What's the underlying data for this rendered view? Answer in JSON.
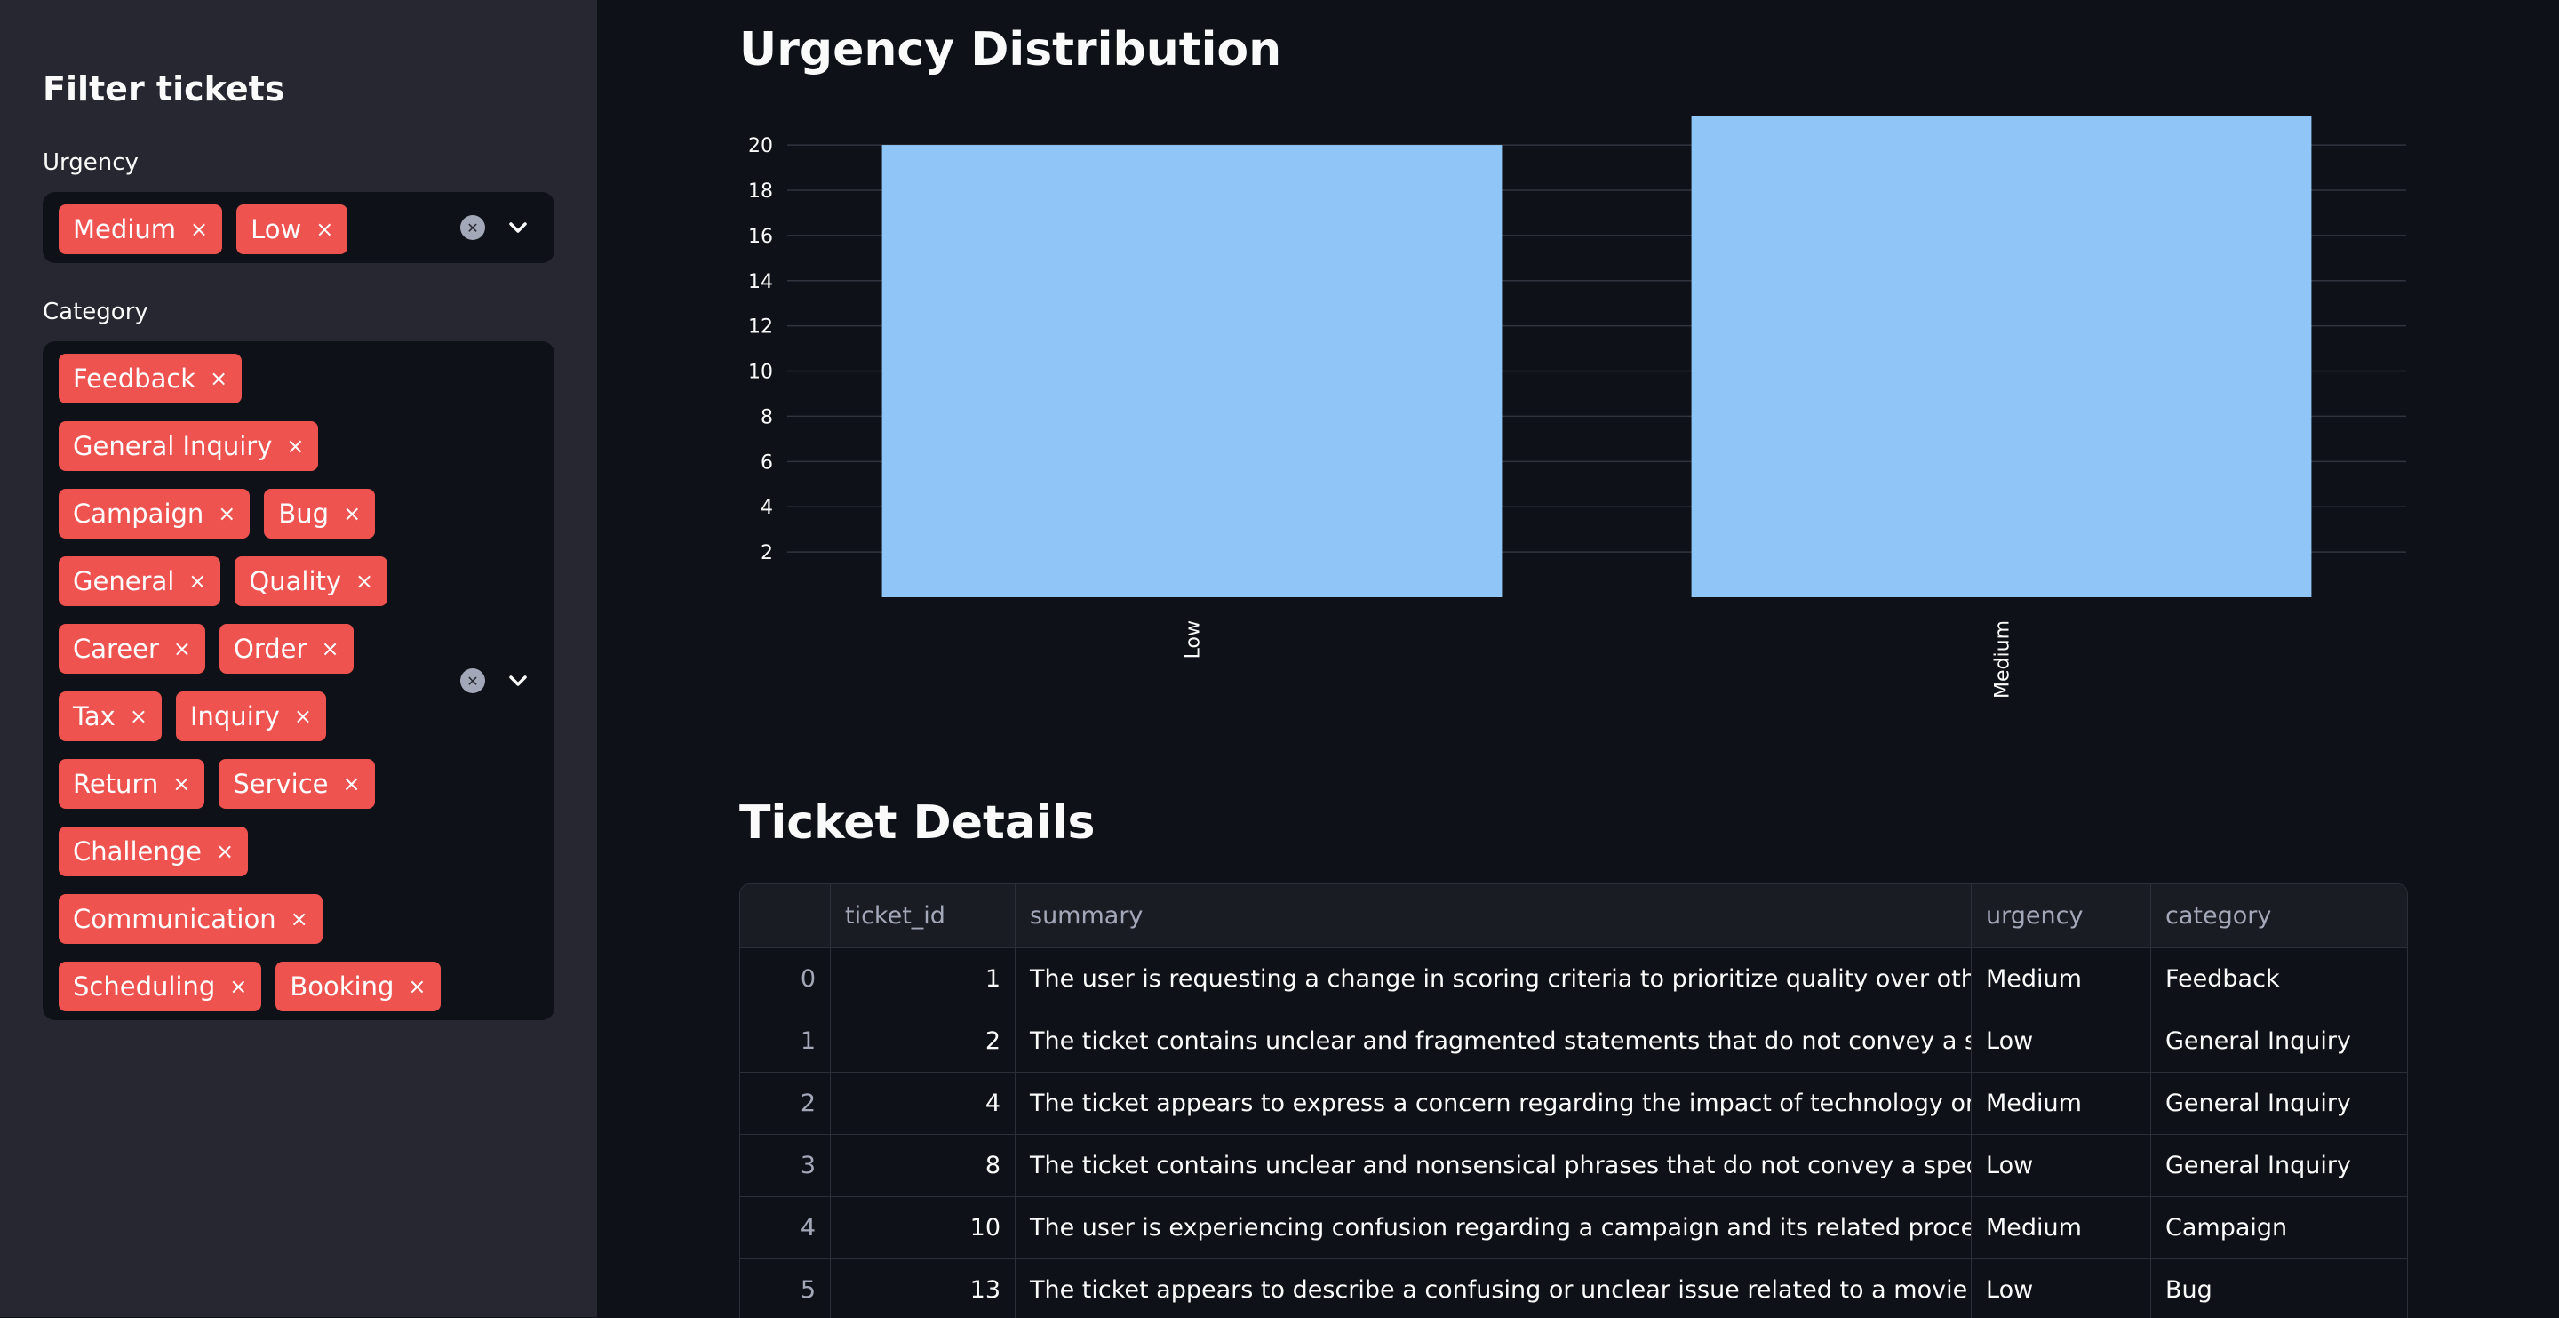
{
  "sidebar": {
    "title": "Filter tickets",
    "urgency_label": "Urgency",
    "urgency_tags": [
      "Medium",
      "Low"
    ],
    "category_label": "Category",
    "category_tags": [
      "Feedback",
      "General Inquiry",
      "Campaign",
      "Bug",
      "General",
      "Quality",
      "Career",
      "Order",
      "Tax",
      "Inquiry",
      "Return",
      "Service",
      "Challenge",
      "Communication",
      "Scheduling",
      "Booking"
    ],
    "tag_remove_glyph": "×"
  },
  "chart_section": {
    "title": "Urgency Distribution"
  },
  "chart_data": {
    "type": "bar",
    "title": "",
    "xlabel": "",
    "ylabel": "",
    "categories": [
      "Low",
      "Medium"
    ],
    "values": [
      20,
      21.3
    ],
    "ylim": [
      0,
      21.3
    ],
    "yticks": [
      2,
      4,
      6,
      8,
      10,
      12,
      14,
      16,
      18,
      20
    ],
    "grid": true,
    "bar_color": "#90c5f7"
  },
  "table_section": {
    "title": "Ticket Details",
    "columns": [
      "",
      "ticket_id",
      "summary",
      "urgency",
      "category"
    ],
    "rows": [
      {
        "idx": "0",
        "ticket_id": "1",
        "summary": "The user is requesting a change in scoring criteria to prioritize quality over other factors.",
        "urgency": "Medium",
        "category": "Feedback"
      },
      {
        "idx": "1",
        "ticket_id": "2",
        "summary": "The ticket contains unclear and fragmented statements that do not convey a specific issue.",
        "urgency": "Low",
        "category": "General Inquiry"
      },
      {
        "idx": "2",
        "ticket_id": "4",
        "summary": "The ticket appears to express a concern regarding the impact of technology on peace and le",
        "urgency": "Medium",
        "category": "General Inquiry"
      },
      {
        "idx": "3",
        "ticket_id": "8",
        "summary": "The ticket contains unclear and nonsensical phrases that do not convey a specific issue.",
        "urgency": "Low",
        "category": "General Inquiry"
      },
      {
        "idx": "4",
        "ticket_id": "10",
        "summary": "The user is experiencing confusion regarding a campaign and its related processes.",
        "urgency": "Medium",
        "category": "Campaign"
      },
      {
        "idx": "5",
        "ticket_id": "13",
        "summary": "The ticket appears to describe a confusing or unclear issue related to a movie cell and kitch",
        "urgency": "Low",
        "category": "Bug"
      }
    ]
  },
  "colors": {
    "background": "#0e1117",
    "sidebar": "#262730",
    "tag": "#ee5350",
    "bar": "#90c5f7"
  },
  "icons": {
    "clear": "clear-icon",
    "dropdown": "chevron-down-icon"
  }
}
